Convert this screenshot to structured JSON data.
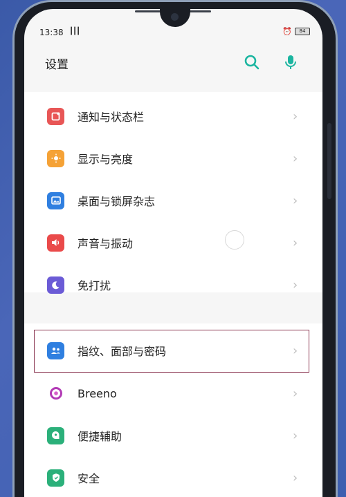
{
  "status_bar": {
    "time": "13:38",
    "signal": "┃┃┃",
    "battery": "84",
    "alarm_icon": "alarm-icon"
  },
  "header": {
    "title": "设置",
    "search_icon": "search-icon",
    "mic_icon": "mic-icon",
    "accent": "#1bb5a0"
  },
  "groups": [
    {
      "items": [
        {
          "label": "通知与状态栏",
          "icon": "notification-icon",
          "color": "#e85656"
        },
        {
          "label": "显示与亮度",
          "icon": "brightness-icon",
          "color": "#f5a236"
        },
        {
          "label": "桌面与锁屏杂志",
          "icon": "wallpaper-icon",
          "color": "#2f7fe0"
        },
        {
          "label": "声音与振动",
          "icon": "sound-icon",
          "color": "#ea4a4a"
        },
        {
          "label": "免打扰",
          "icon": "moon-icon",
          "color": "#6b5bd6"
        }
      ]
    },
    {
      "items": [
        {
          "label": "指纹、面部与密码",
          "icon": "fingerprint-icon",
          "color": "#2f7fe0"
        },
        {
          "label": "Breeno",
          "icon": "breeno-icon",
          "color": "#b23ab5"
        },
        {
          "label": "便捷辅助",
          "icon": "assist-icon",
          "color": "#2bb07a"
        },
        {
          "label": "安全",
          "icon": "shield-icon",
          "color": "#2bb07a"
        }
      ]
    }
  ],
  "chevron": "›"
}
